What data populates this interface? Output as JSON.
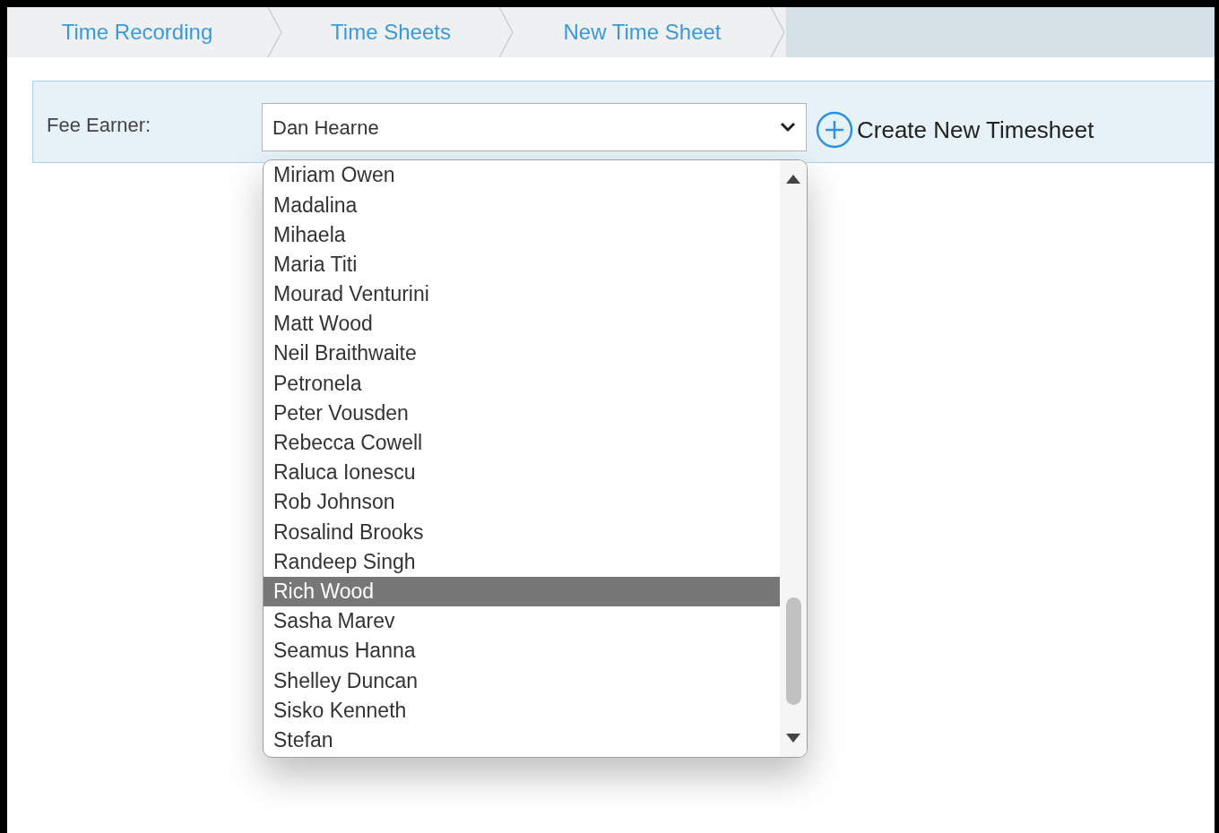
{
  "breadcrumbs": [
    {
      "label": "Time Recording"
    },
    {
      "label": "Time Sheets"
    },
    {
      "label": "New Time Sheet"
    }
  ],
  "fee_earner": {
    "label": "Fee Earner:",
    "value": "Dan Hearne"
  },
  "create_button": {
    "label": "Create New Timesheet"
  },
  "dropdown_options": [
    {
      "label": "Miriam Owen",
      "selected": false
    },
    {
      "label": "Madalina",
      "selected": false
    },
    {
      "label": "Mihaela",
      "selected": false
    },
    {
      "label": "Maria Titi",
      "selected": false
    },
    {
      "label": "Mourad Venturini",
      "selected": false
    },
    {
      "label": "Matt Wood",
      "selected": false
    },
    {
      "label": "Neil Braithwaite",
      "selected": false
    },
    {
      "label": "Petronela",
      "selected": false
    },
    {
      "label": "Peter Vousden",
      "selected": false
    },
    {
      "label": "Rebecca Cowell",
      "selected": false
    },
    {
      "label": "Raluca Ionescu",
      "selected": false
    },
    {
      "label": "Rob Johnson",
      "selected": false
    },
    {
      "label": "Rosalind Brooks",
      "selected": false
    },
    {
      "label": "Randeep Singh",
      "selected": false
    },
    {
      "label": "Rich Wood",
      "selected": true
    },
    {
      "label": "Sasha Marev",
      "selected": false
    },
    {
      "label": "Seamus Hanna",
      "selected": false
    },
    {
      "label": "Shelley Duncan",
      "selected": false
    },
    {
      "label": "Sisko Kenneth",
      "selected": false
    },
    {
      "label": "Stefan",
      "selected": false
    }
  ]
}
